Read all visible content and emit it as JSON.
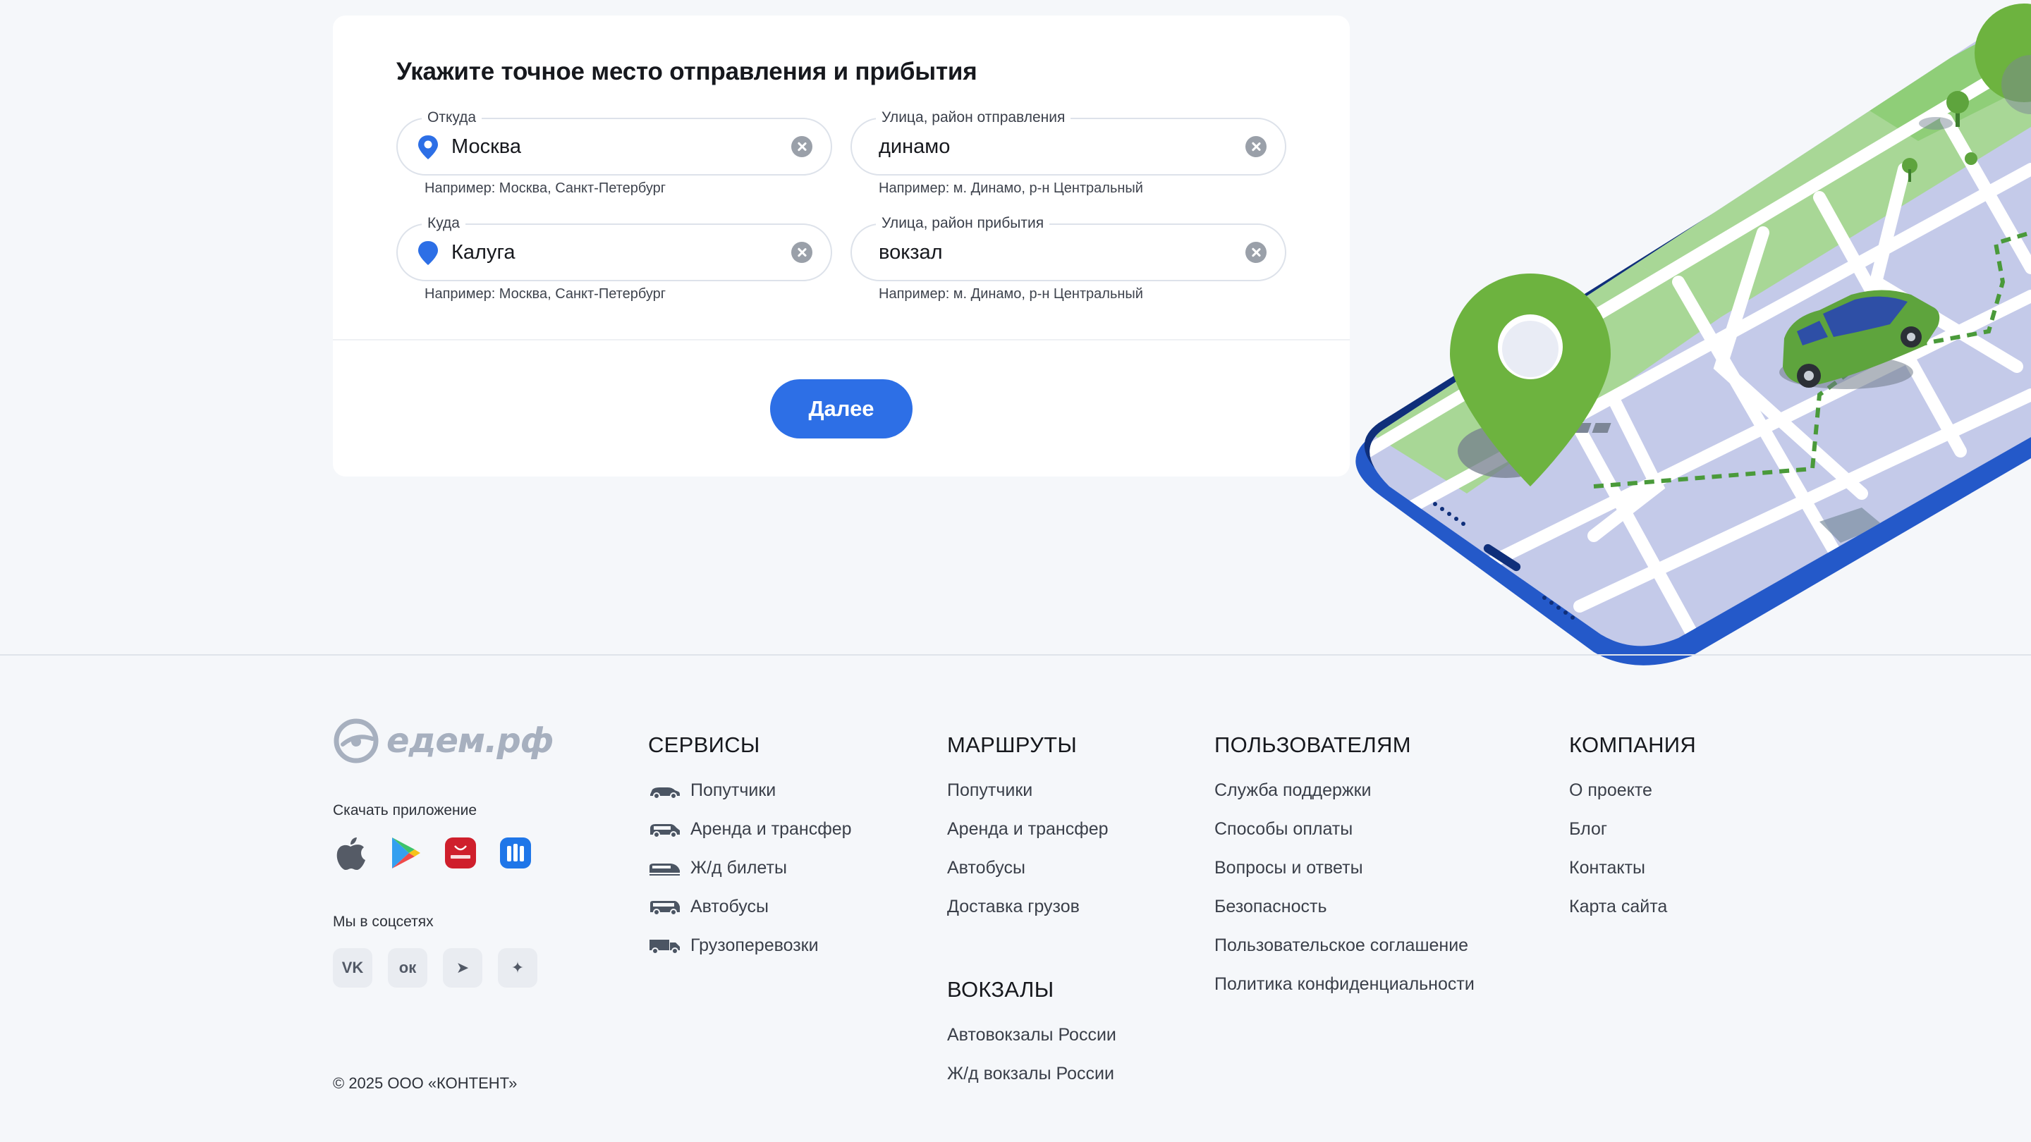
{
  "form": {
    "title": "Укажите точное место отправления и прибытия",
    "from": {
      "label": "Откуда",
      "value": "Москва",
      "hint": "Например: Москва, Санкт-Петербург"
    },
    "from_street": {
      "label": "Улица, район отправления",
      "value": "динамо",
      "hint": "Например: м. Динамо, р-н Центральный"
    },
    "to": {
      "label": "Куда",
      "value": "Калуга",
      "hint": "Например: Москва, Санкт-Петербург"
    },
    "to_street": {
      "label": "Улица, район прибытия",
      "value": "вокзал",
      "hint": "Например: м. Динамо, р-н Центральный"
    },
    "next_label": "Далее"
  },
  "colors": {
    "accent": "#2d6fe6",
    "map_green": "#6db33f",
    "map_blue": "#2459c9"
  },
  "footer": {
    "logo": "едем.рф",
    "download_label": "Скачать приложение",
    "stores": [
      "apple-icon",
      "google-play-icon",
      "huawei-appgallery-icon",
      "rustore-icon"
    ],
    "social_label": "Мы в соцсетях",
    "socials": [
      {
        "icon": "vk-icon",
        "glyph": "VK"
      },
      {
        "icon": "odnoklassniki-icon",
        "glyph": "ок"
      },
      {
        "icon": "telegram-icon",
        "glyph": "➤"
      },
      {
        "icon": "sparkle-icon",
        "glyph": "✦"
      }
    ],
    "copyright": "© 2025 ООО «КОНТЕНТ»",
    "services": {
      "title": "СЕРВИСЫ",
      "items": [
        {
          "label": "Попутчики",
          "icon": "car-icon"
        },
        {
          "label": "Аренда и трансфер",
          "icon": "minivan-icon"
        },
        {
          "label": "Ж/д билеты",
          "icon": "train-icon"
        },
        {
          "label": "Автобусы",
          "icon": "bus-icon"
        },
        {
          "label": "Грузоперевозки",
          "icon": "truck-icon"
        }
      ]
    },
    "routes": {
      "title": "МАРШРУТЫ",
      "items": [
        "Попутчики",
        "Аренда и трансфер",
        "Автобусы",
        "Доставка грузов"
      ]
    },
    "stations": {
      "title": "ВОКЗАЛЫ",
      "items": [
        "Автовокзалы России",
        "Ж/д вокзалы России"
      ]
    },
    "users": {
      "title": "ПОЛЬЗОВАТЕЛЯМ",
      "items": [
        "Служба поддержки",
        "Способы оплаты",
        "Вопросы и ответы",
        "Безопасность",
        "Пользовательское соглашение",
        "Политика конфиденциальности"
      ]
    },
    "company": {
      "title": "КОМПАНИЯ",
      "items": [
        "О проекте",
        "Блог",
        "Контакты",
        "Карта сайта"
      ]
    }
  }
}
